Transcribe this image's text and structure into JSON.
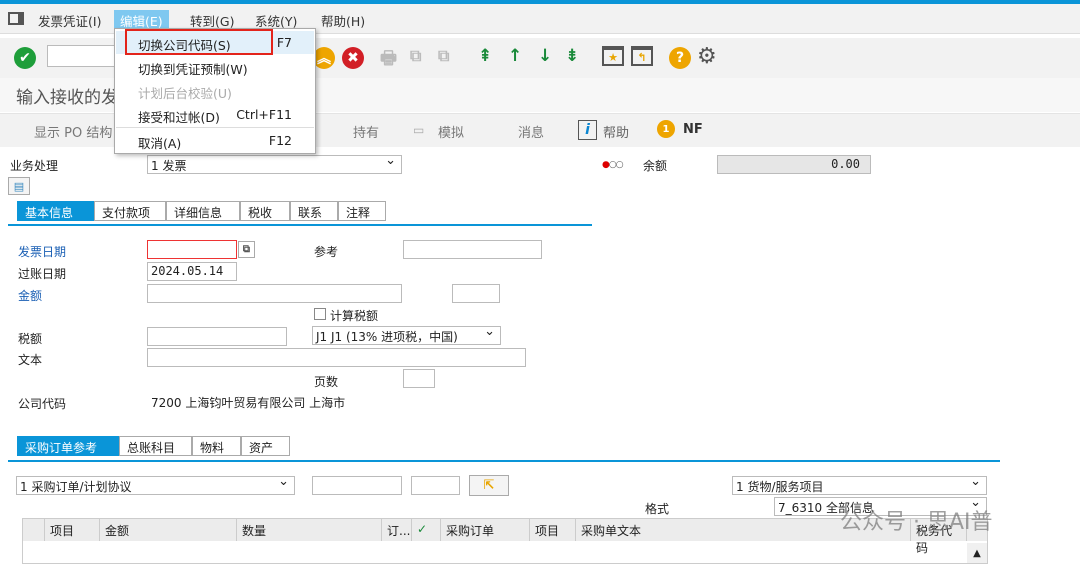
{
  "menubar": {
    "items": [
      "发票凭证(I)",
      "编辑(E)",
      "转到(G)",
      "系统(Y)",
      "帮助(H)"
    ]
  },
  "dropdown": {
    "items": [
      {
        "label": "切换公司代码(S)",
        "shortcut": "F7",
        "state": "highlighted"
      },
      {
        "label": "切换到凭证预制(W)",
        "shortcut": "",
        "state": "normal"
      },
      {
        "label": "计划后台校验(U)",
        "shortcut": "",
        "state": "disabled"
      },
      {
        "label": "接受和过帐(D)",
        "shortcut": "Ctrl+F11",
        "state": "normal"
      },
      {
        "label": "取消(A)",
        "shortcut": "F12",
        "state": "normal"
      }
    ]
  },
  "title": "输入接收的发票",
  "apptoolbar": {
    "show_po": "显示 PO 结构",
    "hold": "持有",
    "simulate": "模拟",
    "messages": "消息",
    "help": "帮助",
    "nf": "NF"
  },
  "form": {
    "transaction_label": "业务处理",
    "transaction_value": "1 发票",
    "balance_label": "余额",
    "balance_value": "0.00",
    "tabs": [
      "基本信息",
      "支付款项",
      "详细信息",
      "税收",
      "联系",
      "注释"
    ],
    "invoice_date_label": "发票日期",
    "invoice_date_value": "",
    "reference_label": "参考",
    "posting_date_label": "过账日期",
    "posting_date_value": "2024.05.14",
    "amount_label": "金额",
    "calc_tax_label": "计算税额",
    "tax_label": "税额",
    "tax_code_value": "J1 J1 (13% 进项税，中国)",
    "text_label": "文本",
    "page_label": "页数",
    "company_label": "公司代码",
    "company_value": "7200 上海钧叶贸易有限公司 上海市"
  },
  "lower": {
    "tabs": [
      "采购订单参考",
      "总账科目",
      "物料",
      "资产"
    ],
    "ref_type": "1 采购订单/计划协议",
    "item_type": "1 货物/服务项目",
    "layout_label": "格式",
    "layout_value": "7_6310 全部信息",
    "columns": [
      "项目",
      "金额",
      "数量",
      "订...",
      "",
      "采购订单",
      "项目",
      "采购单文本",
      "税务代码"
    ]
  },
  "watermark": "公众号 · 思AI普"
}
